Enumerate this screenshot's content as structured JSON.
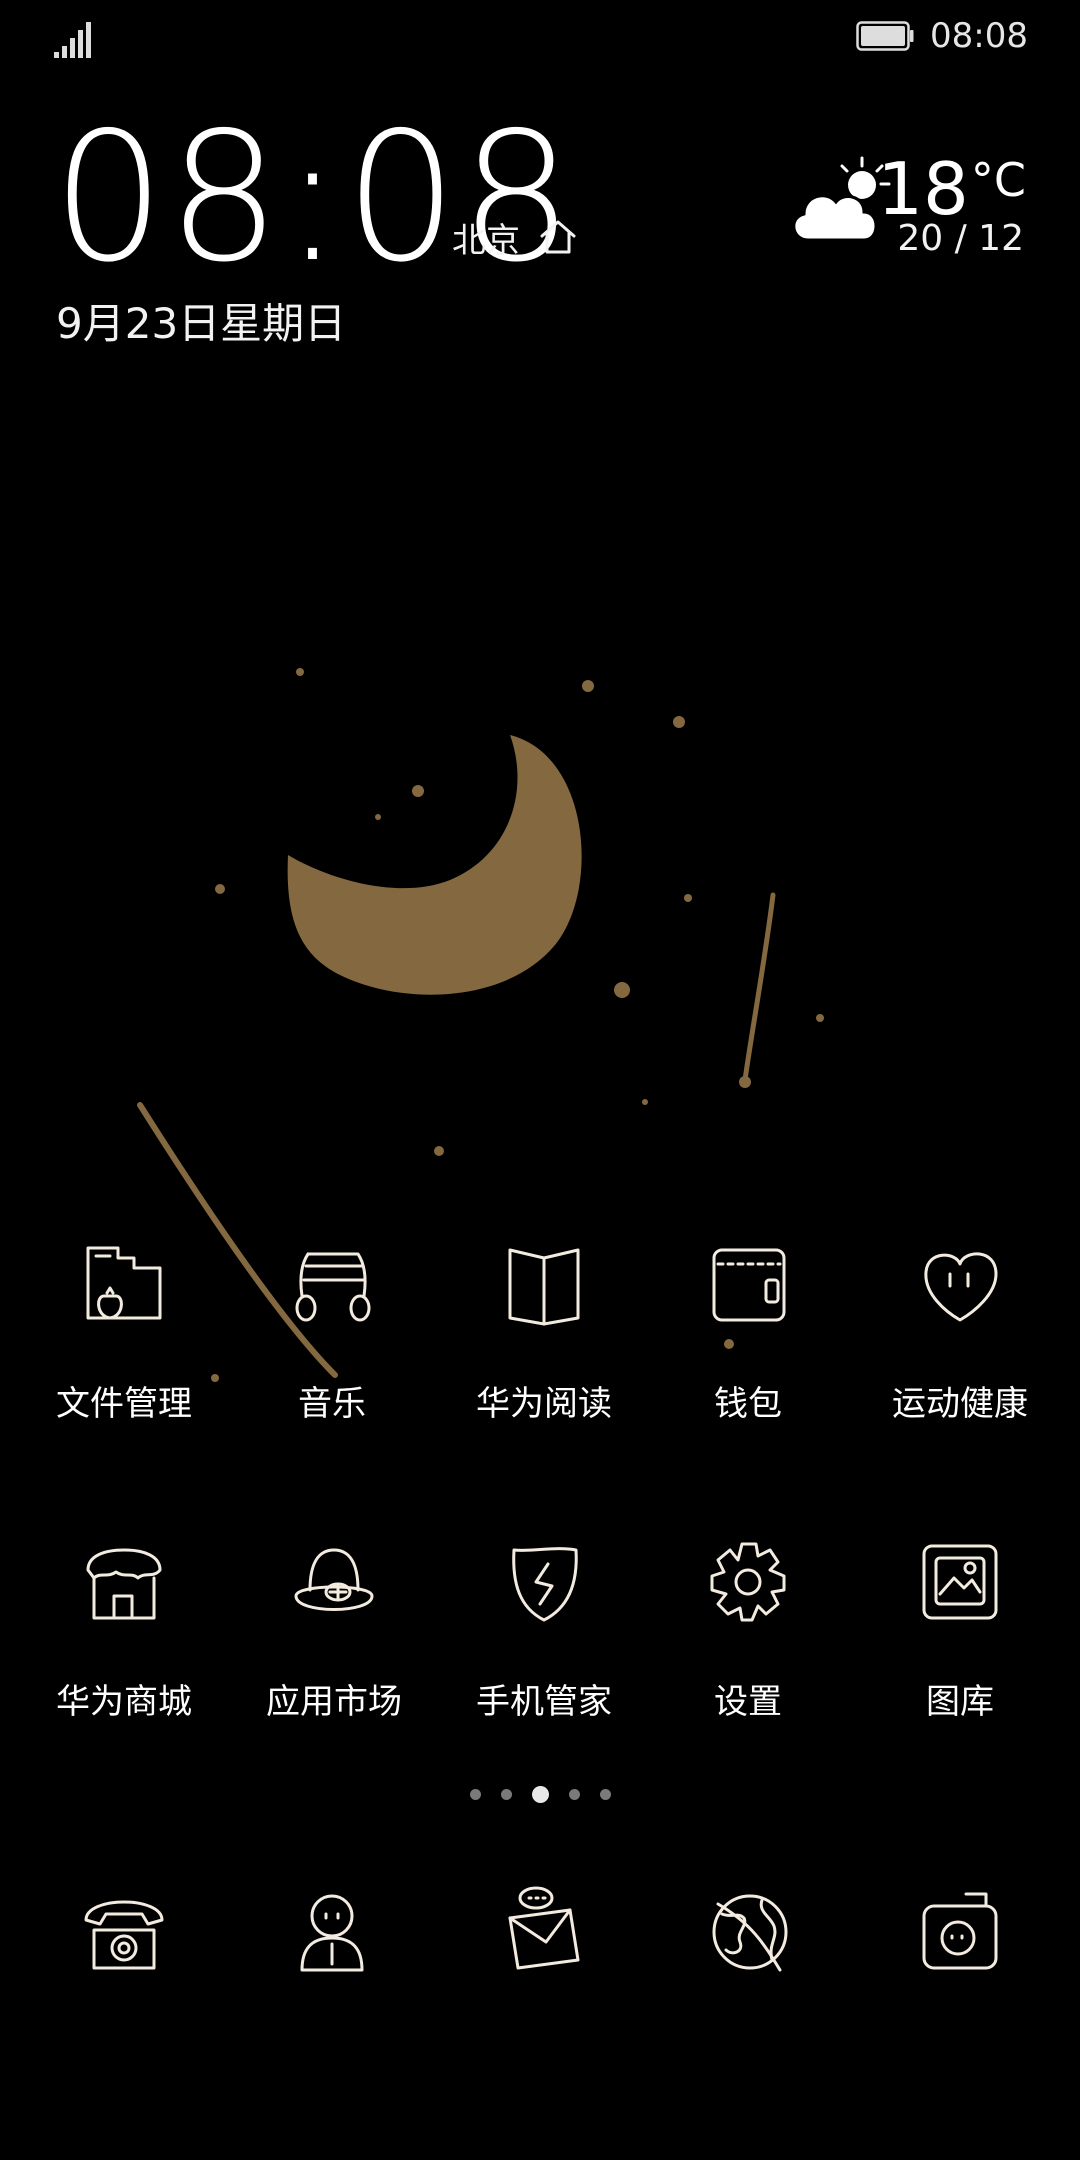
{
  "status_bar": {
    "time": "08:08",
    "signal_icon": "signal-bars-icon",
    "battery_icon": "battery-icon"
  },
  "clock": {
    "time": "08:08",
    "city": "北京",
    "date": "9月23日星期日"
  },
  "weather": {
    "icon": "partly-cloudy-icon",
    "temperature": "18",
    "unit": "°C",
    "range": "20 / 12"
  },
  "apps": [
    {
      "label": "文件管理",
      "icon": "folder-strawberry-icon"
    },
    {
      "label": "音乐",
      "icon": "headphones-icon"
    },
    {
      "label": "华为阅读",
      "icon": "open-book-icon"
    },
    {
      "label": "钱包",
      "icon": "wallet-icon"
    },
    {
      "label": "运动健康",
      "icon": "heart-icon"
    },
    {
      "label": "华为商城",
      "icon": "shop-icon"
    },
    {
      "label": "应用市场",
      "icon": "hat-icon"
    },
    {
      "label": "手机管家",
      "icon": "shield-icon"
    },
    {
      "label": "设置",
      "icon": "gear-icon"
    },
    {
      "label": "图库",
      "icon": "picture-frame-icon"
    }
  ],
  "page_indicator": {
    "count": 5,
    "active_index": 2
  },
  "dock": [
    {
      "icon": "telephone-icon"
    },
    {
      "icon": "contacts-person-icon"
    },
    {
      "icon": "message-envelope-icon"
    },
    {
      "icon": "browser-globe-icon"
    },
    {
      "icon": "camera-icon"
    }
  ],
  "colors": {
    "background": "#000000",
    "moon": "#84683f",
    "icon_stroke": "#f3ebe0"
  }
}
